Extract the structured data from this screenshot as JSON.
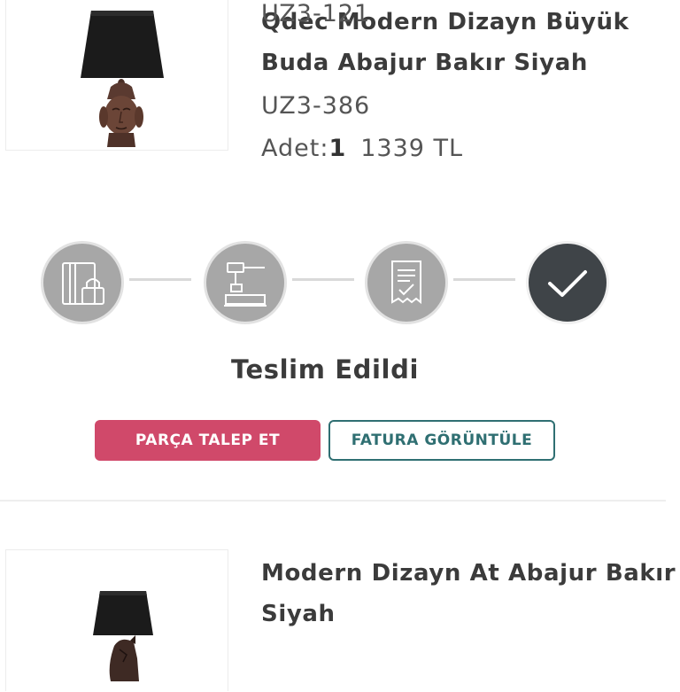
{
  "orders": [
    {
      "title": "Qdec Modern Dizayn Büyük Buda Abajur Bakır Siyah",
      "sku": "UZ3-386",
      "quantity_label": "Adet:",
      "quantity": "1",
      "price": "1339 TL",
      "image": "lamp-buddha"
    },
    {
      "title": "Modern Dizayn At Abajur Bakır Siyah",
      "sku": "UZ3-121",
      "image": "lamp-horse"
    }
  ],
  "tracking": {
    "steps": [
      {
        "icon": "payment-card-lock-icon",
        "state": "completed"
      },
      {
        "icon": "production-hammer-icon",
        "state": "completed"
      },
      {
        "icon": "invoice-receipt-icon",
        "state": "completed"
      },
      {
        "icon": "checkmark-icon",
        "state": "current"
      }
    ],
    "status": "Teslim Edildi"
  },
  "actions": {
    "request_part": "PARÇA TALEP ET",
    "view_invoice": "FATURA GÖRÜNTÜLE"
  },
  "colors": {
    "primary_button": "#d0496a",
    "outline_button": "#2f6f72",
    "step_inactive": "#a7a7a7",
    "step_done": "#3f4448"
  }
}
